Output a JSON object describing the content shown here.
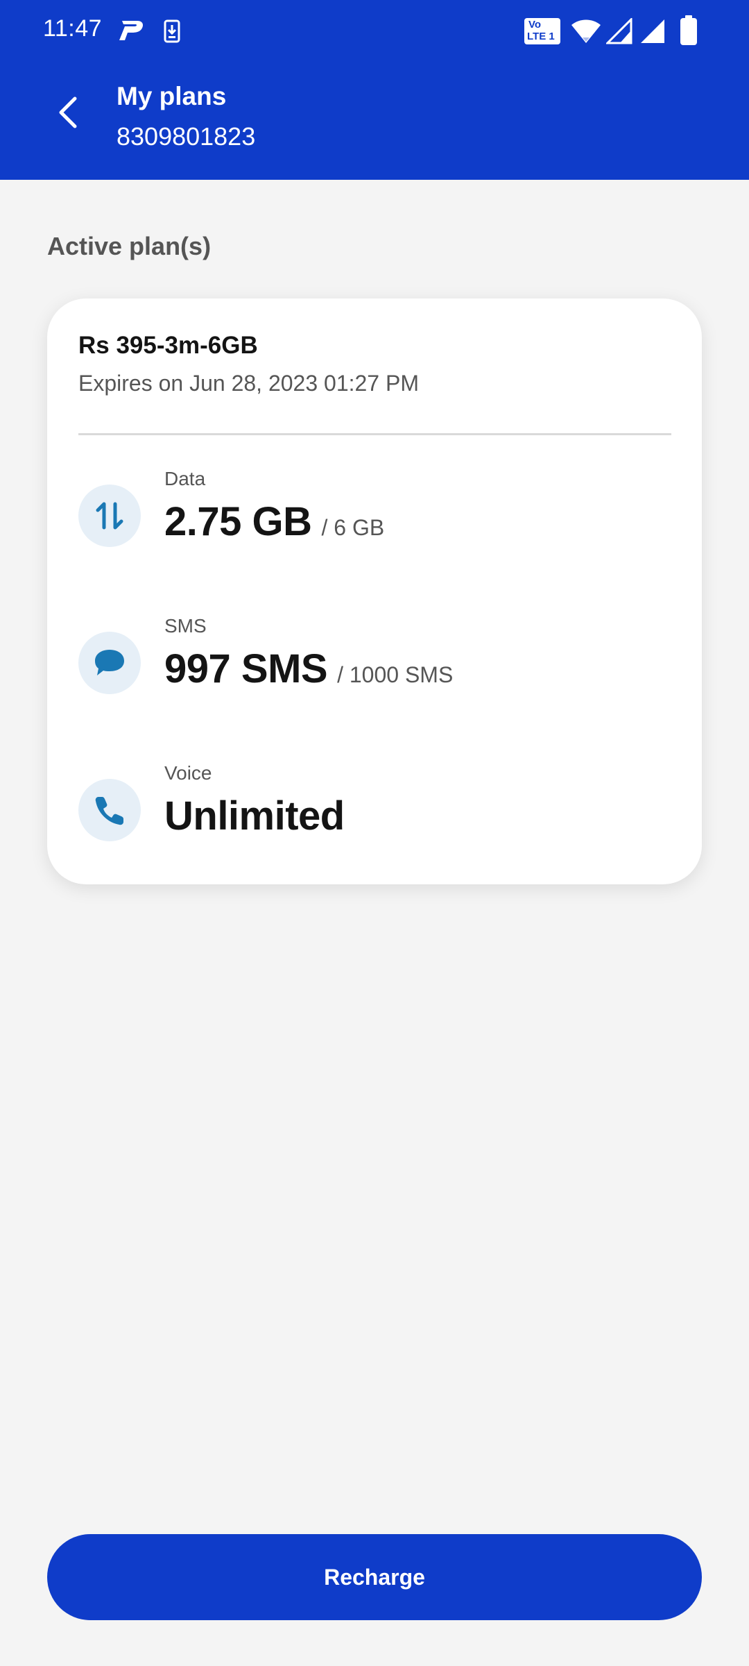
{
  "status_bar": {
    "time": "11:47",
    "network_badge_top": "Vo",
    "network_badge_bottom": "LTE 1",
    "icons": [
      "paytm-notification-icon",
      "download-notification-icon",
      "volte-icon",
      "wifi-icon",
      "signal-partial-icon",
      "signal-full-icon",
      "battery-icon"
    ]
  },
  "header": {
    "title": "My plans",
    "phone_number": "8309801823",
    "background_color": "#0f3cc9"
  },
  "section": {
    "heading": "Active plan(s)"
  },
  "plan": {
    "name": "Rs 395-3m-6GB",
    "expires": "Expires on Jun 28, 2023 01:27 PM",
    "benefits": [
      {
        "label": "Data",
        "value": "2.75 GB",
        "total": "/ 6 GB",
        "icon": "data-transfer-icon"
      },
      {
        "label": "SMS",
        "value": "997 SMS",
        "total": "/ 1000 SMS",
        "icon": "message-bubble-icon"
      },
      {
        "label": "Voice",
        "value": "Unlimited",
        "total": "",
        "icon": "phone-icon"
      }
    ]
  },
  "actions": {
    "recharge_label": "Recharge"
  },
  "colors": {
    "accent": "#0f3cc9",
    "icon_blue": "#1a78b4",
    "icon_bg": "#e6eff7"
  }
}
